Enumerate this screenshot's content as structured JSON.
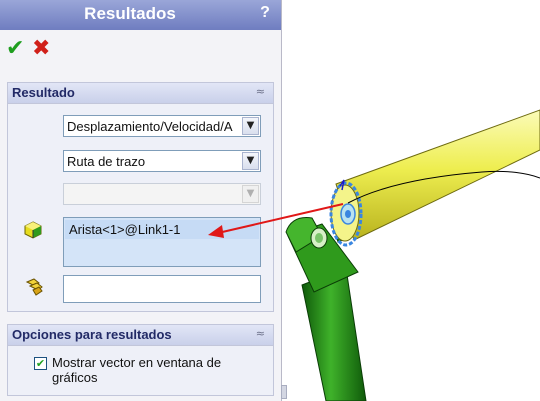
{
  "panel": {
    "title": "Resultados",
    "help_icon": "?",
    "ok_icon": "✔",
    "cancel_icon": "✖"
  },
  "results_section": {
    "title": "Resultado",
    "collapse_glyph": "≈",
    "category_select": "Desplazamiento/Velocidad/A",
    "subcategory_select": "Ruta de trazo",
    "component_select": "",
    "selected_edge": "Arista<1>@Link1-1",
    "component_field": ""
  },
  "options_section": {
    "title": "Opciones para resultados",
    "collapse_glyph": "≈",
    "show_vector_checked": true,
    "show_vector_label": "Mostrar vector en ventana de gráficos"
  },
  "icons": {
    "ok": "check-icon",
    "cancel": "x-icon",
    "edge_selector": "yellow-cube-icon",
    "component_selector": "component-icon"
  },
  "colors": {
    "title_bar": "#7f8cc8",
    "upper_link": "#f0f05a",
    "lower_link": "#2f9a1c",
    "arrow": "#e01818",
    "selection_highlight": "#3a86e0"
  }
}
